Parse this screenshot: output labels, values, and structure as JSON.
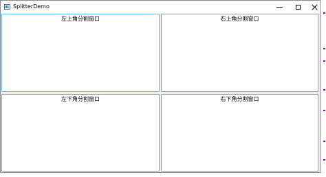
{
  "window": {
    "title": "SplitterDemo",
    "icon": "app-window-icon",
    "controls": [
      "minimize-icon",
      "maximize-icon",
      "close-icon"
    ]
  },
  "panes": {
    "top_left": {
      "label": "左上角分割窗口",
      "focused": true
    },
    "top_right": {
      "label": "右上角分割窗口"
    },
    "bottom_left": {
      "label": "左下角分割窗口"
    },
    "bottom_right": {
      "label": "右下角分割窗口"
    }
  },
  "colors": {
    "focus_border": "#6cb4e6",
    "pane_border": "#9a9a9a",
    "window_background": "#f0f0f0"
  }
}
